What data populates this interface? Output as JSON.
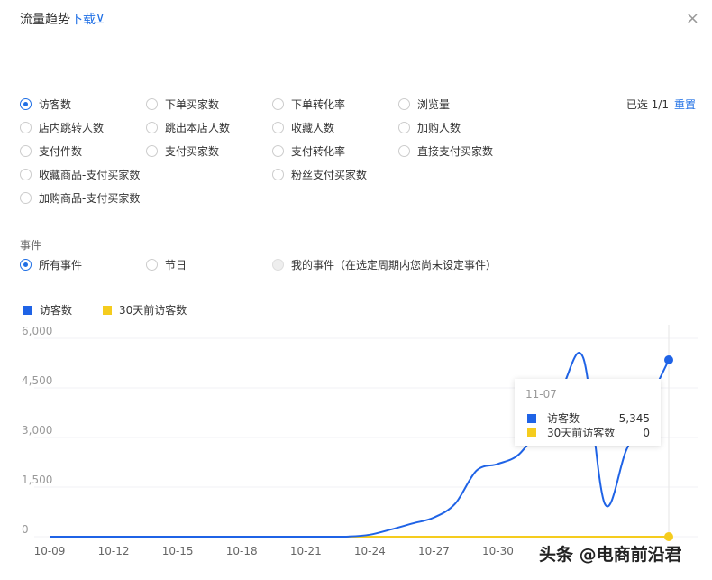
{
  "header": {
    "title": "流量趋势",
    "download": "下载⊻",
    "close": "×"
  },
  "metrics": [
    {
      "label": "访客数",
      "checked": true
    },
    {
      "label": "下单买家数"
    },
    {
      "label": "下单转化率"
    },
    {
      "label": "浏览量"
    },
    {
      "label": "店内跳转人数"
    },
    {
      "label": "跳出本店人数"
    },
    {
      "label": "收藏人数"
    },
    {
      "label": "加购人数"
    },
    {
      "label": "支付件数"
    },
    {
      "label": "支付买家数"
    },
    {
      "label": "支付转化率"
    },
    {
      "label": "直接支付买家数"
    },
    {
      "label": "收藏商品-支付买家数"
    },
    {
      "label": "粉丝支付买家数"
    },
    {
      "label": "加购商品-支付买家数"
    }
  ],
  "selection": {
    "count": "已选 1/1",
    "reset": "重置"
  },
  "events": {
    "label": "事件",
    "options": [
      {
        "label": "所有事件",
        "checked": true
      },
      {
        "label": "节日"
      },
      {
        "label": "我的事件（在选定周期内您尚未设定事件）",
        "disabled": true
      }
    ]
  },
  "tooltip": {
    "date": "11-07",
    "rows": [
      {
        "label": "访客数",
        "value": "5,345"
      },
      {
        "label": "30天前访客数",
        "value": "0"
      }
    ]
  },
  "watermark": "头条 @电商前沿君",
  "chart_data": {
    "type": "line",
    "x": [
      "10-09",
      "10-10",
      "10-11",
      "10-12",
      "10-13",
      "10-14",
      "10-15",
      "10-16",
      "10-17",
      "10-18",
      "10-19",
      "10-20",
      "10-21",
      "10-22",
      "10-23",
      "10-24",
      "10-25",
      "10-26",
      "10-27",
      "10-28",
      "10-29",
      "10-30",
      "10-31",
      "11-01",
      "11-02",
      "11-03",
      "11-04",
      "11-05",
      "11-06",
      "11-07"
    ],
    "xticks": [
      "10-09",
      "10-12",
      "10-15",
      "10-18",
      "10-21",
      "10-24",
      "10-27",
      "10-30"
    ],
    "yticks": [
      "0",
      "1,500",
      "3,000",
      "4,500",
      "6,000"
    ],
    "ylim": [
      0,
      6000
    ],
    "series": [
      {
        "name": "访客数",
        "color": "#1f63e6",
        "values": [
          0,
          0,
          0,
          0,
          0,
          0,
          0,
          0,
          0,
          0,
          0,
          0,
          0,
          0,
          5,
          60,
          220,
          400,
          580,
          1000,
          2000,
          2200,
          2500,
          3400,
          4500,
          5400,
          1000,
          2600,
          4000,
          5345
        ]
      },
      {
        "name": "30天前访客数",
        "color": "#f5cc1e",
        "values": [
          0,
          0,
          0,
          0,
          0,
          0,
          0,
          0,
          0,
          0,
          0,
          0,
          0,
          0,
          0,
          0,
          0,
          0,
          0,
          0,
          0,
          0,
          0,
          0,
          0,
          0,
          0,
          0,
          0,
          0
        ]
      }
    ]
  }
}
